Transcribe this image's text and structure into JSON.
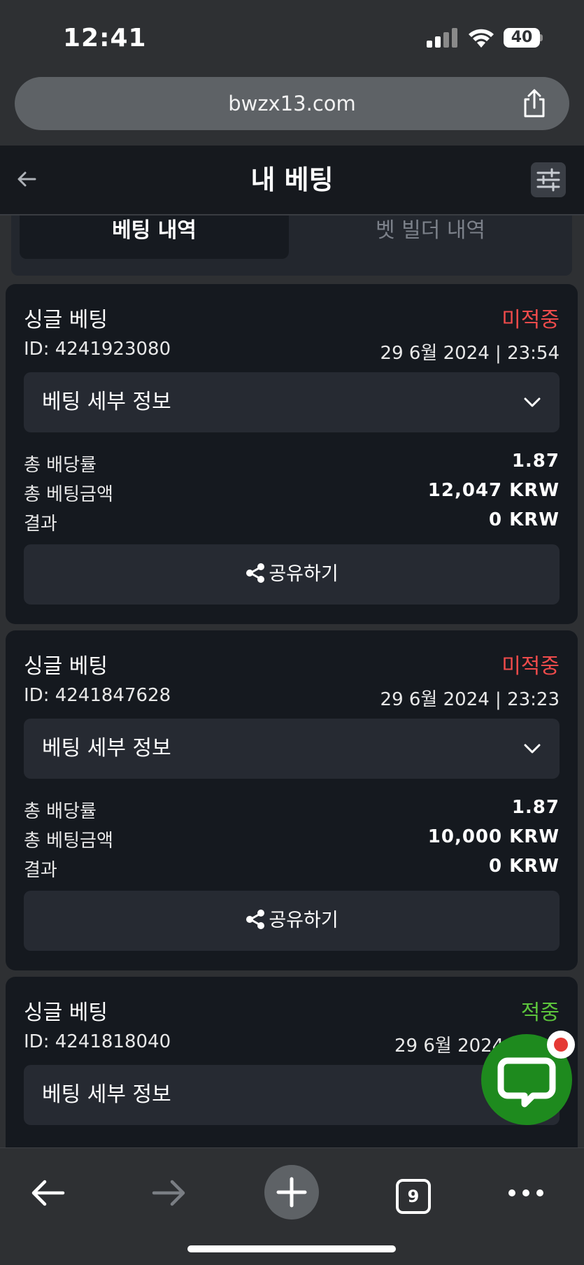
{
  "status_bar": {
    "time": "12:41",
    "battery": "40"
  },
  "browser": {
    "url": "bwzx13.com",
    "tab_count": "9"
  },
  "header": {
    "title": "내 베팅"
  },
  "tabs": [
    {
      "label": "베팅 내역",
      "active": true
    },
    {
      "label": "벳 빌더 내역",
      "active": false
    }
  ],
  "bets": [
    {
      "type": "싱글 베팅",
      "status": "미적중",
      "id": "ID: 4241923080",
      "date": "29 6월 2024 | 23:54",
      "details_label": "베팅 세부 정보",
      "odds_label": "총 배당률",
      "odds": "1.87",
      "stake_label": "총 베팅금액",
      "stake": "12,047 KRW",
      "result_label": "결과",
      "result": "0 KRW",
      "share_label": "공유하기"
    },
    {
      "type": "싱글 베팅",
      "status": "미적중",
      "id": "ID: 4241847628",
      "date": "29 6월 2024 | 23:23",
      "details_label": "베팅 세부 정보",
      "odds_label": "총 배당률",
      "odds": "1.87",
      "stake_label": "총 베팅금액",
      "stake": "10,000 KRW",
      "result_label": "결과",
      "result": "0 KRW",
      "share_label": "공유하기"
    },
    {
      "type": "싱글 베팅",
      "status": "적중",
      "id": "ID: 4241818040",
      "date": "29 6월 2024 |",
      "details_label": "베팅 세부 정보"
    }
  ],
  "colors": {
    "lost": "#ef4b4b",
    "won": "#5cc43c",
    "chat": "#1e8a1e"
  }
}
